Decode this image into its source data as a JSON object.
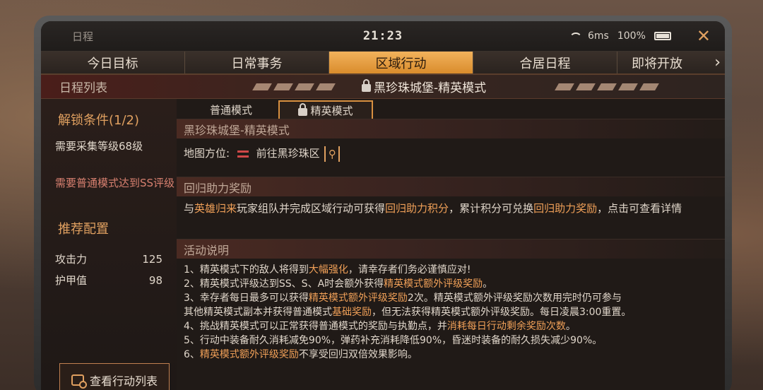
{
  "statusbar": {
    "title": "日程",
    "time": "21:23",
    "latency": "6ms",
    "battery": "100%",
    "close_icon": "close-icon"
  },
  "tabs": [
    {
      "label": "今日目标",
      "active": false
    },
    {
      "label": "日常事务",
      "active": false
    },
    {
      "label": "区域行动",
      "active": true
    },
    {
      "label": "合居日程",
      "active": false
    },
    {
      "label": "即将开放",
      "active": false
    }
  ],
  "header": {
    "left": "日程列表",
    "title": "黑珍珠城堡-精英模式"
  },
  "sidebar": {
    "unlock_heading": "解锁条件(1/2)",
    "req1": "需要采集等级68级",
    "req2": "需要普通模式达到SS评级",
    "rec_heading": "推荐配置",
    "stats": [
      {
        "label": "攻击力",
        "value": "125"
      },
      {
        "label": "护甲值",
        "value": "98"
      }
    ],
    "button_label": "查看行动列表"
  },
  "content": {
    "subtabs": [
      {
        "label": "普通模式",
        "active": false
      },
      {
        "label": "精英模式",
        "active": true
      }
    ],
    "section1_title": "黑珍珠城堡-精英模式",
    "map_label": "地图方位:",
    "map_link": "前往黑珍珠区",
    "section2_title": "回归助力奖励",
    "reward_prefix": "与",
    "reward_hl1": "英雄归来",
    "reward_mid1": "玩家组队并完成区域行动可获得",
    "reward_hl2": "回归助力积分",
    "reward_mid2": "，累计积分可兑换",
    "reward_hl3": "回归助力奖励",
    "reward_suffix": "，点击可查看详情",
    "section3_title": "活动说明",
    "lines": [
      {
        "a": "1、精英模式下的敌人将得到",
        "h": "大幅强化",
        "b": "，请幸存者们务必谨慎应对!"
      },
      {
        "a": "2、精英模式评级达到SS、S、A时会额外获得",
        "h": "精英模式额外评级奖励",
        "b": "。"
      },
      {
        "a": "3、幸存者每日最多可以获得",
        "h": "精英模式额外评级奖励",
        "b": "2次。精英模式额外评级奖励次数用完时仍可参与"
      },
      {
        "a": "其他精英模式副本并获得普通模式",
        "h": "基础奖励",
        "b": "，但无法获得精英模式额外评级奖励。每日凌晨3:00重置。"
      },
      {
        "a": "4、挑战精英模式可以正常获得普通模式的奖励与执勤点，并",
        "h": "消耗每日行动剩余奖励次数",
        "b": "。"
      },
      {
        "a": "5、行动中装备耐久消耗减免90%，弹药补充消耗降低90%，昏迷时装备的耐久损失减少90%。",
        "h": "",
        "b": ""
      },
      {
        "a": "6、",
        "h": "精英模式额外评级奖励",
        "b": "不享受回归双倍效果影响。"
      }
    ]
  }
}
